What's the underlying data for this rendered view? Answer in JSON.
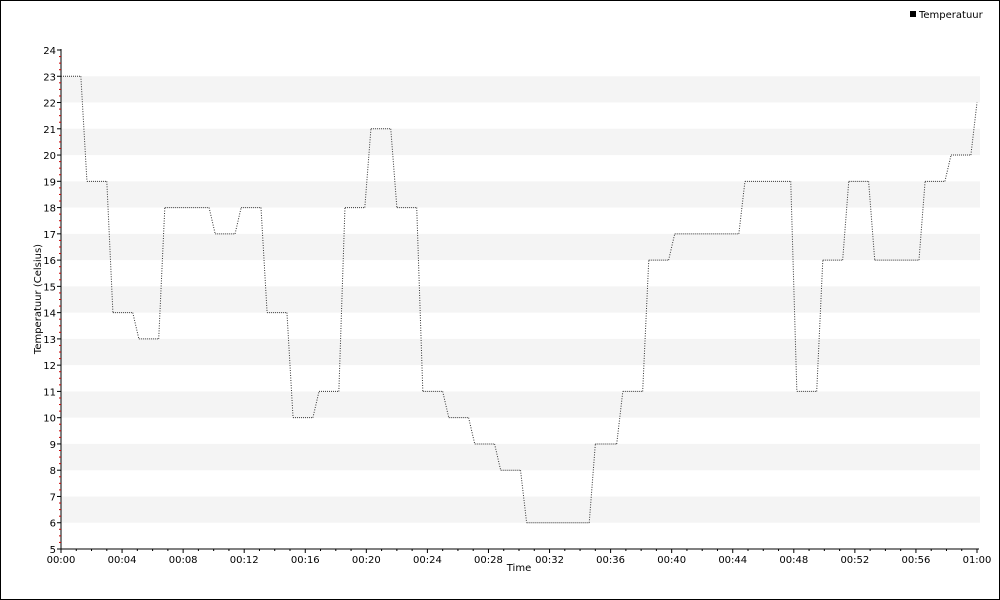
{
  "chart_data": {
    "type": "line",
    "xlabel": "Time",
    "ylabel": "Temperatuur (Celsius)",
    "ylim": [
      5,
      24
    ],
    "yticks": [
      5,
      6,
      7,
      8,
      9,
      10,
      11,
      12,
      13,
      14,
      15,
      16,
      17,
      18,
      19,
      20,
      21,
      22,
      23,
      24
    ],
    "xlim": [
      0,
      60
    ],
    "xticks": [
      "00:00",
      "00:04",
      "00:08",
      "00:12",
      "00:16",
      "00:20",
      "00:24",
      "00:28",
      "00:32",
      "00:36",
      "00:40",
      "00:44",
      "00:48",
      "00:52",
      "00:56",
      "01:00"
    ],
    "grid": "alternating horizontal bands",
    "legend_position": "top-right",
    "series": [
      {
        "name": "Temperatuur",
        "color": "#333333",
        "x": [
          0.0,
          1.3,
          1.7,
          3.0,
          3.4,
          4.7,
          5.1,
          6.4,
          6.8,
          9.7,
          10.1,
          11.4,
          11.8,
          13.1,
          13.5,
          14.8,
          15.2,
          16.5,
          16.9,
          18.2,
          18.6,
          19.9,
          20.3,
          21.6,
          22.0,
          23.3,
          23.7,
          25.0,
          25.4,
          26.7,
          27.1,
          28.4,
          28.8,
          30.1,
          30.5,
          34.6,
          35.0,
          36.4,
          36.8,
          38.1,
          38.5,
          39.8,
          40.2,
          44.4,
          44.8,
          47.8,
          48.2,
          49.5,
          49.9,
          51.2,
          51.6,
          52.9,
          53.3,
          56.2,
          56.6,
          57.9,
          58.3,
          59.6,
          60.0
        ],
        "values": [
          23,
          23,
          19,
          19,
          14,
          14,
          13,
          13,
          18,
          18,
          17,
          17,
          18,
          18,
          14,
          14,
          10,
          10,
          11,
          11,
          18,
          18,
          21,
          21,
          18,
          18,
          11,
          11,
          10,
          10,
          9,
          9,
          8,
          8,
          6,
          6,
          9,
          9,
          11,
          11,
          16,
          16,
          17,
          17,
          19,
          19,
          11,
          11,
          16,
          16,
          19,
          19,
          16,
          16,
          19,
          19,
          20,
          20,
          22
        ]
      }
    ]
  }
}
